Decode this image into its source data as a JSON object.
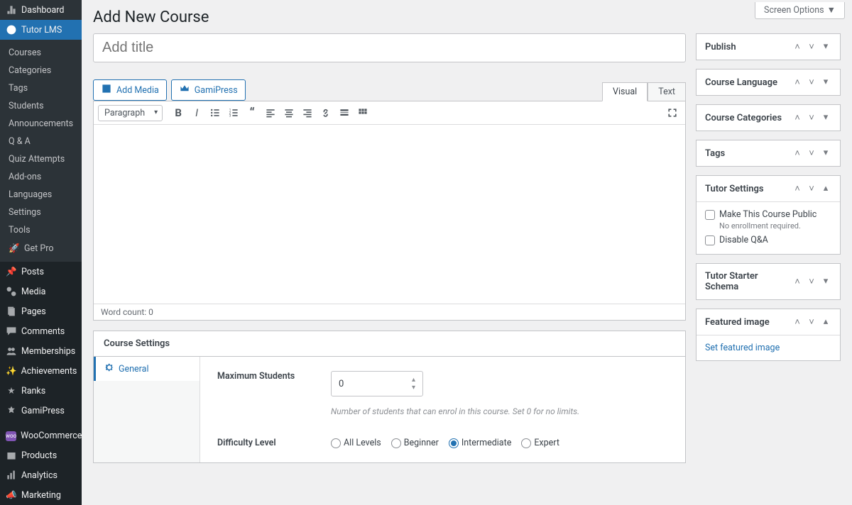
{
  "header": {
    "page_title": "Add New Course",
    "screen_options": "Screen Options"
  },
  "sidebar": {
    "dashboard": "Dashboard",
    "tutor_lms": "Tutor LMS",
    "sub_items": [
      "Courses",
      "Categories",
      "Tags",
      "Students",
      "Announcements",
      "Q & A",
      "Quiz Attempts",
      "Add-ons",
      "Languages",
      "Settings",
      "Tools"
    ],
    "get_pro": "Get Pro",
    "main_items": [
      "Posts",
      "Media",
      "Pages",
      "Comments",
      "Memberships",
      "Achievements",
      "Ranks",
      "GamiPress",
      "WooCommerce",
      "Products",
      "Analytics",
      "Marketing"
    ]
  },
  "editor": {
    "title_placeholder": "Add title",
    "add_media": "Add Media",
    "gamipress": "GamiPress",
    "tab_visual": "Visual",
    "tab_text": "Text",
    "paragraph": "Paragraph",
    "word_count": "Word count: 0"
  },
  "course_settings": {
    "title": "Course Settings",
    "tab_general": "General",
    "max_students_label": "Maximum Students",
    "max_students_value": "0",
    "max_students_hint": "Number of students that can enrol in this course. Set 0 for no limits.",
    "difficulty_label": "Difficulty Level",
    "levels": [
      "All Levels",
      "Beginner",
      "Intermediate",
      "Expert"
    ],
    "selected_level": 2
  },
  "metaboxes": {
    "publish": "Publish",
    "course_language": "Course Language",
    "course_categories": "Course Categories",
    "tags": "Tags",
    "tutor_settings": "Tutor Settings",
    "tutor_public": "Make This Course Public",
    "tutor_public_hint": "No enrollment required.",
    "disable_qa": "Disable Q&A",
    "tutor_starter": "Tutor Starter Schema",
    "featured_image": "Featured image",
    "set_featured": "Set featured image"
  }
}
